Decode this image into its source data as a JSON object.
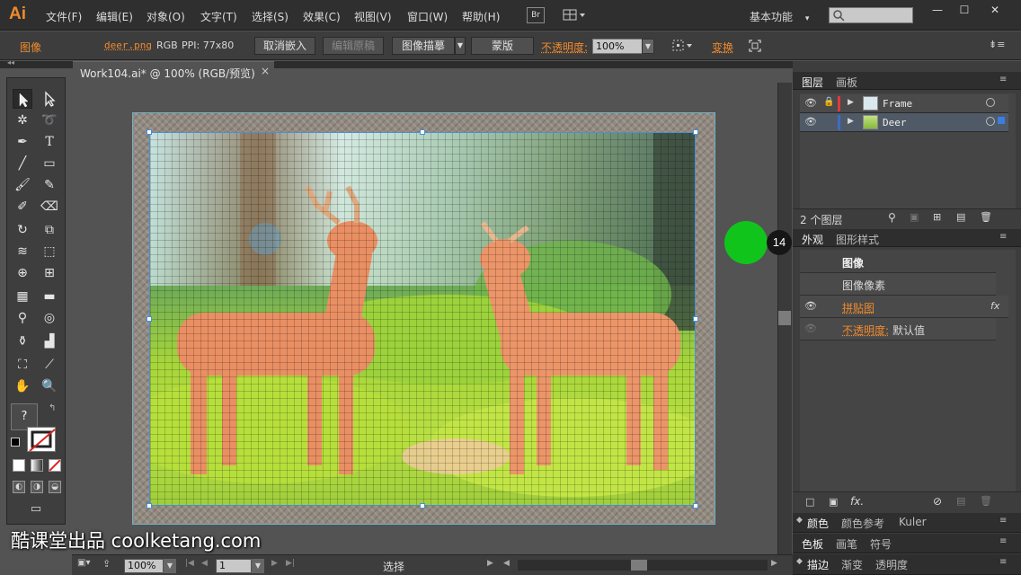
{
  "app": {
    "logo": "Ai"
  },
  "menu": {
    "items": [
      "文件(F)",
      "编辑(E)",
      "对象(O)",
      "文字(T)",
      "选择(S)",
      "效果(C)",
      "视图(V)",
      "窗口(W)",
      "帮助(H)"
    ],
    "bridge_label": "Br",
    "workspace_label": "基本功能",
    "window_controls": [
      "—",
      "☐",
      "✕"
    ]
  },
  "control_bar": {
    "type_label": "图像",
    "file_link": "deer.png",
    "color_mode": "RGB",
    "ppi": "PPI: 77x80",
    "unembed_button": "取消嵌入",
    "edit_original_button": "编辑原稿",
    "image_trace_button": "图像描摹",
    "mask_button": "蒙版",
    "opacity_label": "不透明度:",
    "opacity_value": "100%",
    "transform_label": "变换"
  },
  "document": {
    "tab_title": "Work104.ai* @ 100% (RGB/预览)",
    "tab_close": "×"
  },
  "tools": {
    "icons": [
      "selection-arrow-icon",
      "direct-selection-icon",
      "magic-wand-icon",
      "lasso-icon",
      "pen-icon",
      "type-icon",
      "line-icon",
      "rectangle-icon",
      "paintbrush-icon",
      "pencil-icon",
      "blob-brush-icon",
      "eraser-icon",
      "rotate-icon",
      "scale-icon",
      "warp-icon",
      "free-transform-icon",
      "shape-builder-icon",
      "perspective-grid-icon",
      "mesh-icon",
      "gradient-icon",
      "eyedropper-icon",
      "blend-icon",
      "symbol-sprayer-icon",
      "column-graph-icon",
      "artboard-icon",
      "slice-icon",
      "hand-icon",
      "zoom-icon"
    ],
    "fill_unknown": "?"
  },
  "layers_panel": {
    "tabs": [
      "图层",
      "画板"
    ],
    "layers": [
      {
        "name": "Frame",
        "color": "#e0393c"
      },
      {
        "name": "Deer",
        "color": "#3b6cc9"
      }
    ],
    "count_label": "2 个图层"
  },
  "appearance_panel": {
    "tabs": [
      "外观",
      "图形样式"
    ],
    "rows": [
      "图像",
      "图像像素",
      "拼贴图",
      "不透明度:",
      "默认值"
    ]
  },
  "bottom_panels": {
    "row1": [
      "颜色",
      "颜色参考",
      "Kuler"
    ],
    "row2": [
      "色板",
      "画笔",
      "符号"
    ],
    "row3": [
      "描边",
      "渐变",
      "透明度"
    ]
  },
  "status_bar": {
    "zoom": "100%",
    "artboard_number": "1",
    "tool_label": "选择"
  },
  "overlay": {
    "step_number": "14",
    "watermark": "酷课堂出品 coolketang.com"
  },
  "colors": {
    "accent_orange": "#f08a2c",
    "indicator_green": "#11c41c",
    "selection_blue": "#4a8fd8"
  }
}
